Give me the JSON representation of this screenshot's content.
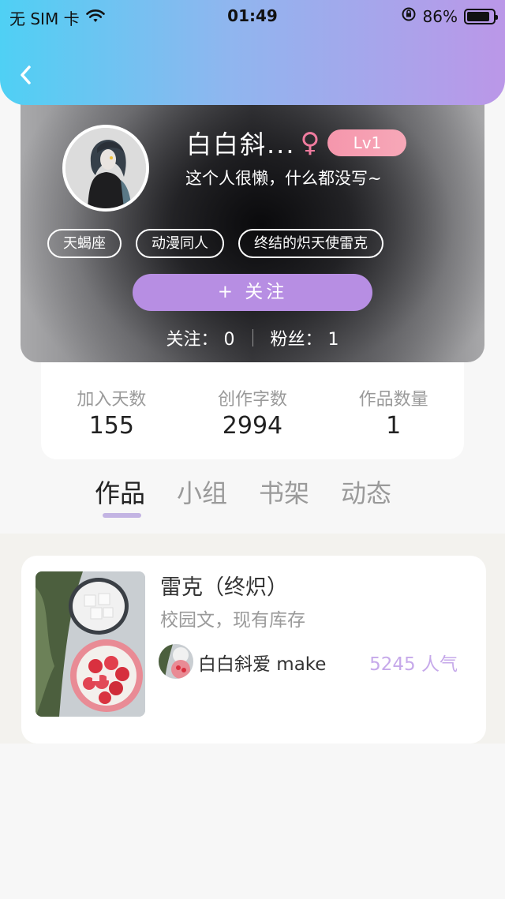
{
  "status_bar": {
    "carrier": "无 SIM 卡",
    "time": "01:49",
    "battery_percent": "86%",
    "battery_level": 0.86
  },
  "profile": {
    "name": "白白斜...",
    "gender_symbol": "♀",
    "level": "Lv1",
    "bio": "这个人很懒，什么都没写~",
    "tags": [
      "天蝎座",
      "动漫同人",
      "终结的炽天使雷克"
    ],
    "follow_button": "+  关注",
    "following_label": "关注：",
    "following_count": "0",
    "followers_label": "粉丝：",
    "followers_count": "1"
  },
  "stats": [
    {
      "label": "加入天数",
      "value": "155"
    },
    {
      "label": "创作字数",
      "value": "2994"
    },
    {
      "label": "作品数量",
      "value": "1"
    }
  ],
  "tabs": [
    {
      "label": "作品",
      "active": true
    },
    {
      "label": "小组",
      "active": false
    },
    {
      "label": "书架",
      "active": false
    },
    {
      "label": "动态",
      "active": false
    }
  ],
  "works": [
    {
      "title": "雷克（终炽）",
      "description": "校园文，现有库存",
      "author": "白白斜爱 make",
      "popularity": "5245 人气"
    }
  ],
  "colors": {
    "accent_purple": "#b78ee3",
    "level_pink": "#f596ac",
    "popularity_purple": "#c6a9ea"
  }
}
